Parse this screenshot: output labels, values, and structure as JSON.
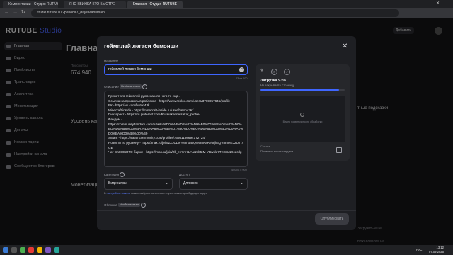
{
  "browser": {
    "tabs": [
      {
        "label": "Комментарии - Студия RUTUBE"
      },
      {
        "label": "Я Ю КВИНКА КТО БЫСТРЕ"
      },
      {
        "label": "Главная - Студия RUTUBE"
      }
    ],
    "url": "studio.rutube.ru/?period=7_days&tab=main"
  },
  "app": {
    "logo_main": "RUTUBE",
    "logo_sub": "Studio",
    "add_button": "Добавить"
  },
  "sidebar": {
    "items": [
      {
        "label": "Главная",
        "active": true
      },
      {
        "label": "Видео"
      },
      {
        "label": "Плейлисты"
      },
      {
        "label": "Трансляции"
      },
      {
        "label": "Аналитика"
      },
      {
        "label": "Монетизация"
      },
      {
        "label": "Уровень канала"
      },
      {
        "label": "Донаты"
      },
      {
        "label": "Комментарии"
      },
      {
        "label": "Настройки канала"
      },
      {
        "label": "Сообщество блогеров"
      }
    ]
  },
  "background": {
    "page_title": "Главна",
    "stat_label": "Просмотры",
    "stat_value": "674 940",
    "level_title": "Уровень кана",
    "monet_title": "Монетизация",
    "hints_title": "тные подсказки",
    "upload_btn": "Загрузить ещё",
    "channel": "пожаловался на"
  },
  "modal": {
    "title": "геймплей легаси бемонши",
    "name_label": "Название",
    "name_value": "геймплей легаси бемонши",
    "name_counter": "23 из 100",
    "desc_label": "Описание",
    "desc_badge": "Необязательно",
    "description": "Привет это геймплей русмена или чего то ещё.\nСсылка на профиль в роблоксе - https://www.roblox.com/users/3769957645/profile\nВК - https://vk.com/baton43k\nMinecraft inside - https://minecraft-inside.ru/user/baton43K/\nПинтерест - https://ru.pinterest.com/Russiakennetsaka/_profile/\nФандом -\nhttps://community.fandom.com/ru/wiki/%D0%A3%D1%87%D0%B0%D1%81%D1%82%D0%BD%D0%B8%D0%BA:%D0%A8%D0%B5%D1%80%D0%BC%D0%B0%D0%BD%D0%A1%D0%BA%D0%B8%D0%B9\nSteam - https://steamcommunity.com/profiles/76561198694172724/\nНовости по русмену - https://max.ru/join/ZZJUL9-YNmoacQnMmNaRebrjh6QVnmMEJ2UTf7GE\nЧат ВКЛЮКОТО бирже - https://max.ru/join/2ll_eY7rn7LA-azcb5tM-YBwsle7TXCcL1Xcas.lg",
    "desc_counter": "400 из 5 000",
    "category_label": "Категория",
    "category_value": "Видеоигры",
    "access_label": "Доступ",
    "access_value": "Для всех",
    "info_prefix": "В ",
    "info_link": "настройках канала",
    "info_suffix": " можно выбрать категорию по умолчанию для будущих видео",
    "cover_label": "Обложка",
    "cover_badge": "Необязательно",
    "publish_button": "Опубликовать",
    "upload": {
      "status": "Загрузка 93%",
      "subtitle": "Не закрывайте страницу",
      "progress": 0.93,
      "thumb_text": "Видео появится после обработки",
      "link_label": "Ссылка",
      "link_value": "Появится после загрузки"
    }
  },
  "taskbar": {
    "time": "13:12",
    "date": "07.09.2025",
    "lang": "РУС"
  },
  "colors": {
    "accent": "#3f66ff",
    "bg": "#141416",
    "modal": "#1e1f23"
  }
}
